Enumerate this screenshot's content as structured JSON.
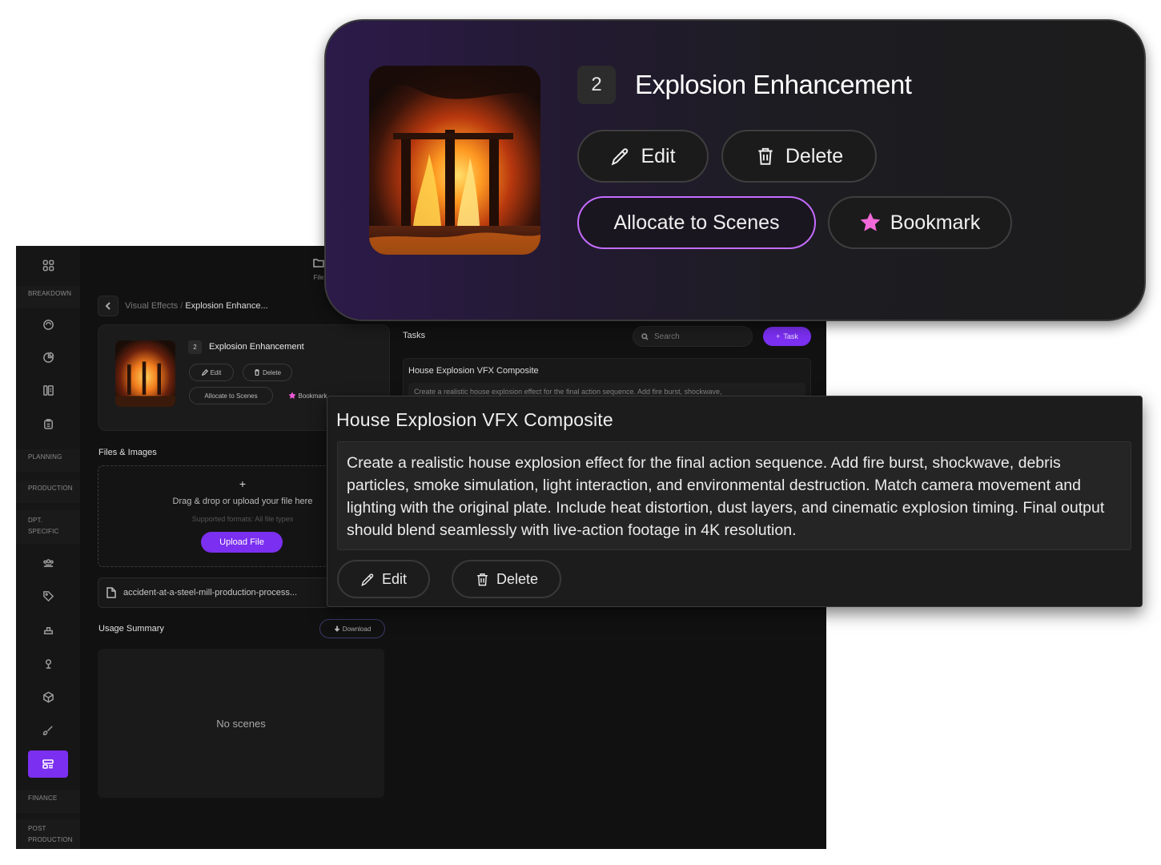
{
  "app": {
    "sidebar": {
      "labels": [
        "BREAKDOWN",
        "PLANNING",
        "PRODUCTION",
        "DPT. SPECIFIC",
        "FINANCE",
        "POST PRODUCTION"
      ],
      "dpt_specific_line1": "DPT.",
      "dpt_specific_line2": "SPECIFIC",
      "post_production_line1": "POST",
      "post_production_line2": "PRODUCTION"
    },
    "files_tab_label": "File",
    "breadcrumb": {
      "parent": "Visual Effects",
      "separator": "/",
      "current": "Explosion Enhance..."
    },
    "asset_card": {
      "number": "2",
      "title": "Explosion Enhancement",
      "edit_label": "Edit",
      "delete_label": "Delete",
      "allocate_label": "Allocate to Scenes",
      "bookmark_label": "Bookmark"
    },
    "files": {
      "section_title": "Files & Images",
      "plus": "+",
      "drop_text": "Drag & drop or upload your file here",
      "supported": "Supported formats: All file types",
      "upload_label": "Upload File",
      "file_name": "accident-at-a-steel-mill-production-process..."
    },
    "usage": {
      "section_title": "Usage Summary",
      "download_label": "Download",
      "empty_text": "No scenes"
    },
    "tasks": {
      "section_title": "Tasks",
      "search_placeholder": "Search",
      "add_task_label": "Task",
      "card_title": "House Explosion VFX Composite",
      "card_desc_preview": "Create a realistic house explosion effect for the final action sequence. Add fire burst, shockwave,"
    }
  },
  "overlay_top": {
    "number": "2",
    "title": "Explosion Enhancement",
    "edit_label": "Edit",
    "delete_label": "Delete",
    "allocate_label": "Allocate to Scenes",
    "bookmark_label": "Bookmark"
  },
  "overlay_task": {
    "title": "House Explosion VFX Composite",
    "description": "Create a realistic house explosion effect for the final action sequence. Add fire burst, shockwave, debris particles, smoke simulation, light interaction, and environmental destruction. Match camera movement and lighting with the original plate. Include heat distortion, dust layers, and cinematic explosion timing. Final output should blend seamlessly with live-action footage in 4K resolution.",
    "edit_label": "Edit",
    "delete_label": "Delete"
  },
  "colors": {
    "accent": "#7b2ff0",
    "bookmark_star": "#f26ad9",
    "allocate_border": "#c56cff"
  }
}
